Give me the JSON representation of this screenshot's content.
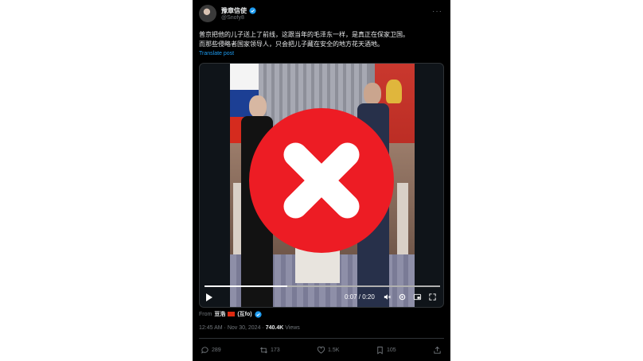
{
  "author": {
    "display_name": "豫章信使",
    "handle": "@Snofy8",
    "verified": true
  },
  "post": {
    "text_line1": "普京把他的儿子送上了前线，这跟当年的毛泽东一样，是真正在保家卫国。",
    "text_line2": "而那些侵略者国家领导人，只会把儿子藏在安全的地方花天酒地。",
    "translate_label": "Translate post"
  },
  "video": {
    "current_time": "0:07",
    "duration": "0:20",
    "time_text": "0:07 / 0:20",
    "progress_fraction": 0.35
  },
  "source": {
    "from_label": "From",
    "name_left": "豆浩",
    "name_right": "(互fo)"
  },
  "meta": {
    "time": "12:45 AM",
    "date": "Nov 30, 2024",
    "views_count": "740.4K",
    "views_label": "Views",
    "separator": "·"
  },
  "actions": {
    "replies": "289",
    "reposts": "173",
    "likes": "1.5K",
    "bookmarks": "105"
  },
  "colors": {
    "background": "#000000",
    "text": "#e7e9ea",
    "muted": "#71767b",
    "link": "#1d9bf0",
    "overlay_red": "#ed1c24"
  },
  "icons": [
    "verified-badge-icon",
    "more-icon",
    "play-icon",
    "volume-icon",
    "settings-icon",
    "pip-icon",
    "fullscreen-icon",
    "reply-icon",
    "repost-icon",
    "like-icon",
    "bookmark-icon",
    "share-icon",
    "check-icon"
  ]
}
